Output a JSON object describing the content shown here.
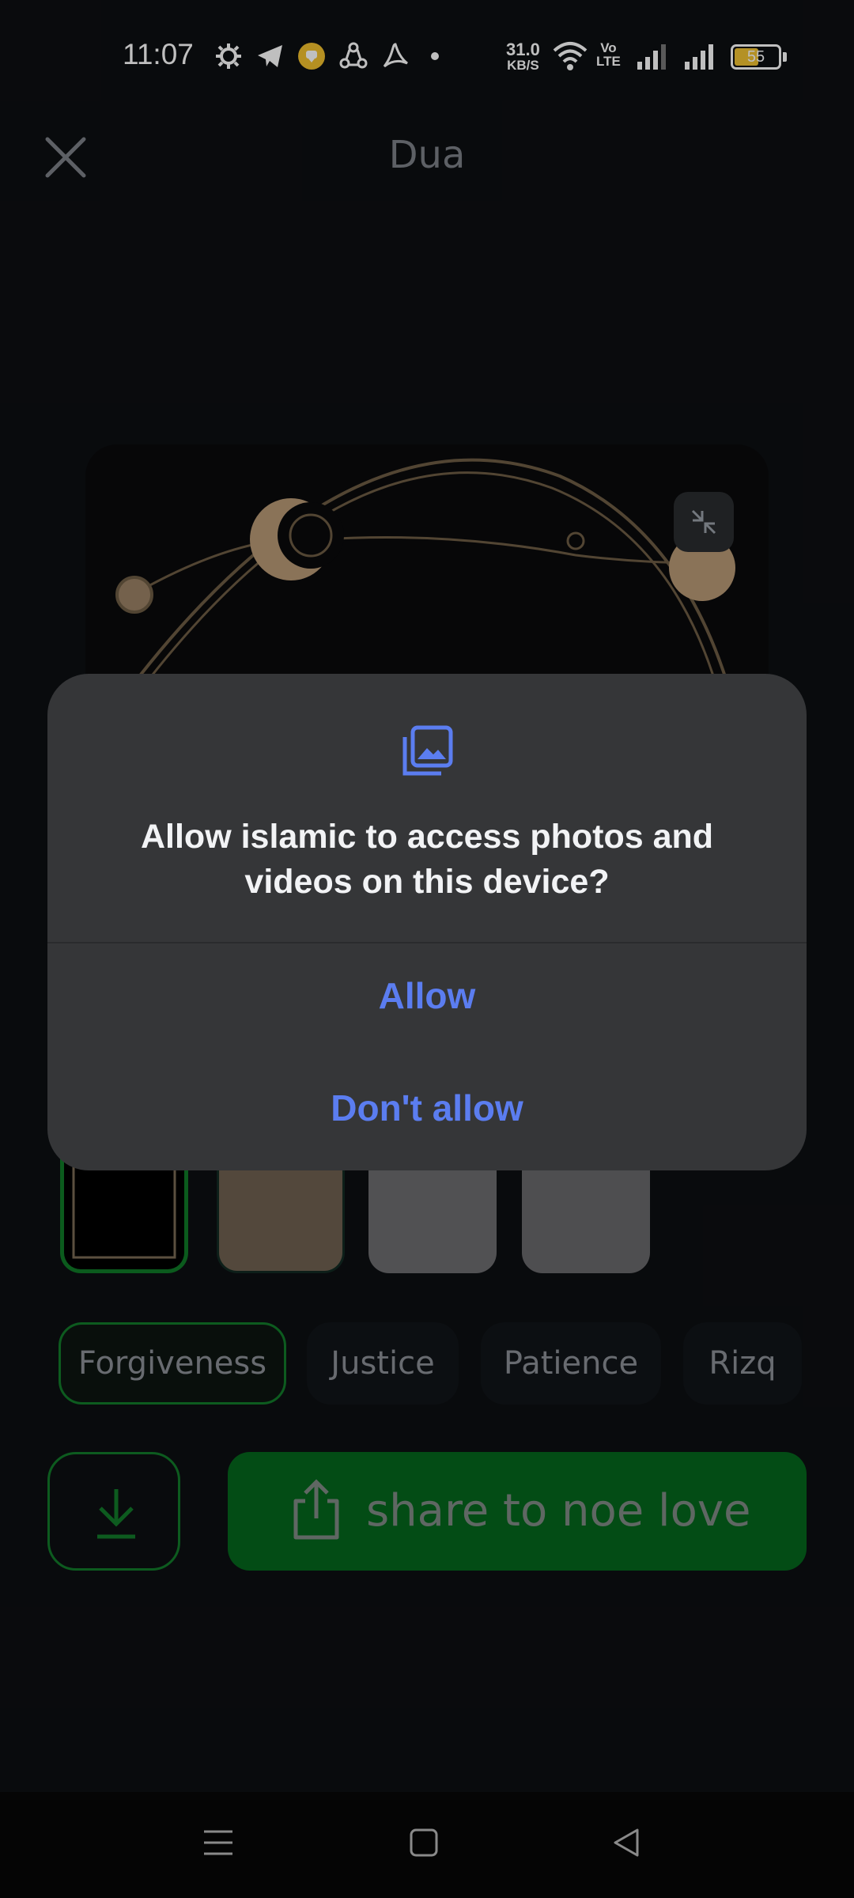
{
  "status_bar": {
    "time": "11:07",
    "net_speed_value": "31.0",
    "net_speed_unit": "KB/S",
    "volte_label_top": "Vo",
    "volte_label_bottom": "LTE",
    "battery_level": "55",
    "battery_fraction": 0.55,
    "icons": [
      "settings-gear-icon",
      "telegram-icon",
      "app-notification-icon",
      "share-it-icon",
      "acrobat-icon",
      "more-dot-icon",
      "wifi-icon",
      "signal-icon",
      "signal-icon",
      "battery-icon"
    ]
  },
  "header": {
    "title": "Dua",
    "close_icon": "close-icon"
  },
  "preview": {
    "collapse_icon": "collapse-icon"
  },
  "thumbnails": [
    "dark-arch-frame",
    "gold-frame",
    "light-ornament-frame",
    "light-ornament-frame-2"
  ],
  "categories": {
    "items": [
      "Forgiveness",
      "Justice",
      "Patience",
      "Rizq"
    ],
    "selected": "Forgiveness"
  },
  "actions": {
    "download_icon": "download-icon",
    "share_label": "share to noe love",
    "share_icon": "share-icon"
  },
  "dialog": {
    "icon": "photos-icon",
    "title": "Allow islamic to access photos and videos on this device?",
    "allow_label": "Allow",
    "deny_label": "Don't allow"
  },
  "nav": {
    "icons": [
      "menu-icon",
      "home-icon",
      "back-icon"
    ]
  },
  "colors": {
    "accent_green": "#04661c",
    "dialog_bg": "#353638",
    "dialog_button": "#5b7df0",
    "battery": "#f1c232"
  }
}
